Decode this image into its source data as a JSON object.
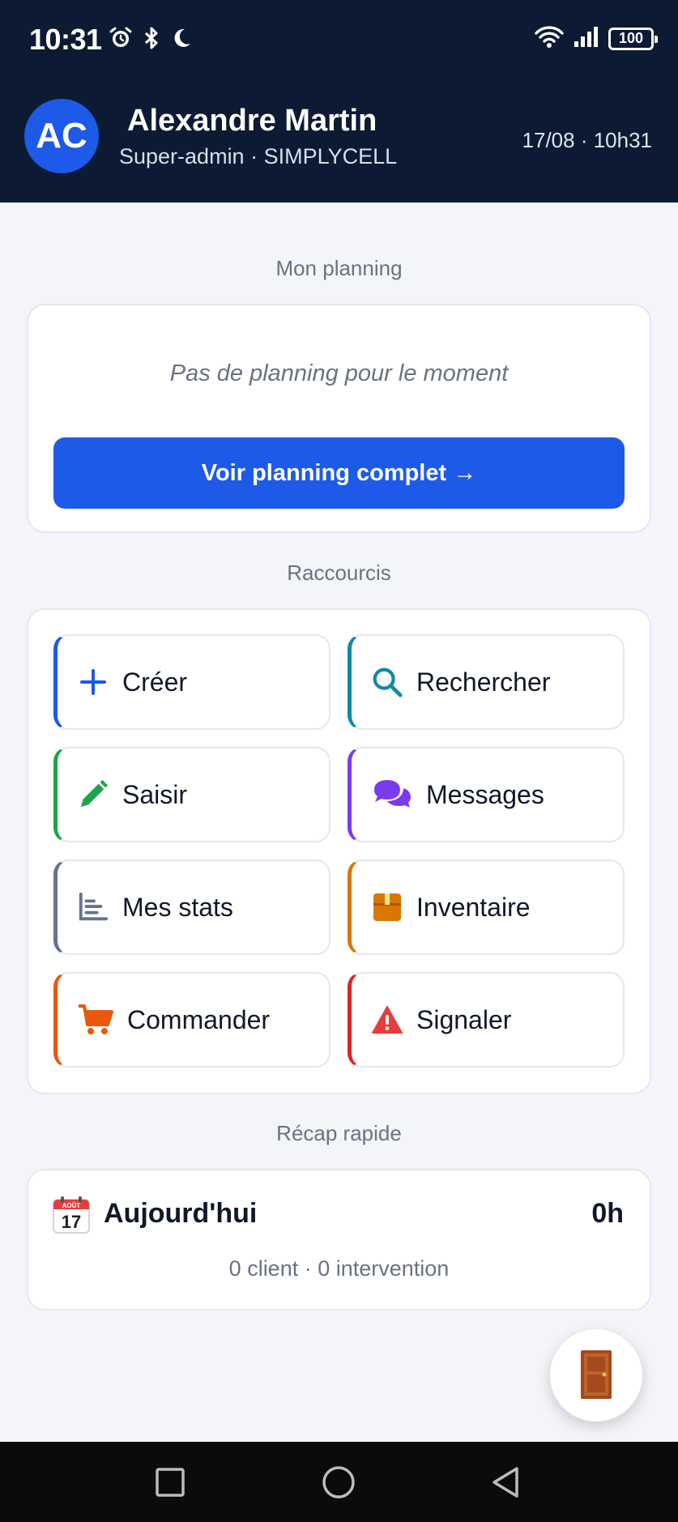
{
  "status_bar": {
    "time": "10:31",
    "battery": "100",
    "icons_left": [
      "alarm-icon",
      "bluetooth-icon",
      "moon-icon"
    ],
    "icons_right": [
      "wifi-icon",
      "signal-icon",
      "battery-icon"
    ]
  },
  "header": {
    "avatar_initials": "AC",
    "user_name": "Alexandre Martin",
    "user_role": "Super-admin · SIMPLYCELL",
    "datetime": "17/08 · 10h31"
  },
  "planning": {
    "section_title": "Mon planning",
    "empty_text": "Pas de planning pour le moment",
    "button_label": "Voir planning complet →"
  },
  "shortcuts": {
    "section_title": "Raccourcis",
    "items": [
      {
        "label": "Créer",
        "icon": "plus-icon",
        "color": "#1d5ae8"
      },
      {
        "label": "Rechercher",
        "icon": "search-icon",
        "color": "#0e8aa6"
      },
      {
        "label": "Saisir",
        "icon": "pencil-icon",
        "color": "#1fa34a"
      },
      {
        "label": "Messages",
        "icon": "chat-icon",
        "color": "#7c3aed"
      },
      {
        "label": "Mes stats",
        "icon": "stats-icon",
        "color": "#64748b"
      },
      {
        "label": "Inventaire",
        "icon": "box-icon",
        "color": "#d97706"
      },
      {
        "label": "Commander",
        "icon": "cart-icon",
        "color": "#ea580c"
      },
      {
        "label": "Signaler",
        "icon": "warning-icon",
        "color": "#dc2626"
      }
    ]
  },
  "recap": {
    "section_title": "Récap rapide",
    "calendar_month": "AOÛT",
    "calendar_day": "17",
    "label": "Aujourd'hui",
    "hours": "0h",
    "summary": "0 client · 0 intervention"
  },
  "fab": {
    "icon": "door-icon"
  },
  "nav_bar": {
    "items": [
      "recents-square-icon",
      "home-circle-icon",
      "back-triangle-icon"
    ]
  }
}
